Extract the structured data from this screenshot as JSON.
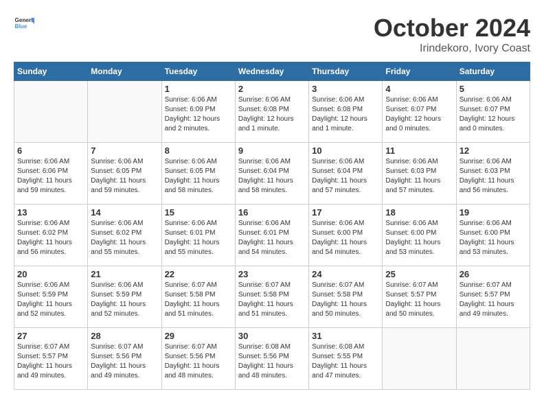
{
  "logo": {
    "general": "General",
    "blue": "Blue"
  },
  "header": {
    "month": "October 2024",
    "location": "Irindekoro, Ivory Coast"
  },
  "weekdays": [
    "Sunday",
    "Monday",
    "Tuesday",
    "Wednesday",
    "Thursday",
    "Friday",
    "Saturday"
  ],
  "weeks": [
    [
      {
        "day": "",
        "info": ""
      },
      {
        "day": "",
        "info": ""
      },
      {
        "day": "1",
        "info": "Sunrise: 6:06 AM\nSunset: 6:09 PM\nDaylight: 12 hours\nand 2 minutes."
      },
      {
        "day": "2",
        "info": "Sunrise: 6:06 AM\nSunset: 6:08 PM\nDaylight: 12 hours\nand 1 minute."
      },
      {
        "day": "3",
        "info": "Sunrise: 6:06 AM\nSunset: 6:08 PM\nDaylight: 12 hours\nand 1 minute."
      },
      {
        "day": "4",
        "info": "Sunrise: 6:06 AM\nSunset: 6:07 PM\nDaylight: 12 hours\nand 0 minutes."
      },
      {
        "day": "5",
        "info": "Sunrise: 6:06 AM\nSunset: 6:07 PM\nDaylight: 12 hours\nand 0 minutes."
      }
    ],
    [
      {
        "day": "6",
        "info": "Sunrise: 6:06 AM\nSunset: 6:06 PM\nDaylight: 11 hours\nand 59 minutes."
      },
      {
        "day": "7",
        "info": "Sunrise: 6:06 AM\nSunset: 6:05 PM\nDaylight: 11 hours\nand 59 minutes."
      },
      {
        "day": "8",
        "info": "Sunrise: 6:06 AM\nSunset: 6:05 PM\nDaylight: 11 hours\nand 58 minutes."
      },
      {
        "day": "9",
        "info": "Sunrise: 6:06 AM\nSunset: 6:04 PM\nDaylight: 11 hours\nand 58 minutes."
      },
      {
        "day": "10",
        "info": "Sunrise: 6:06 AM\nSunset: 6:04 PM\nDaylight: 11 hours\nand 57 minutes."
      },
      {
        "day": "11",
        "info": "Sunrise: 6:06 AM\nSunset: 6:03 PM\nDaylight: 11 hours\nand 57 minutes."
      },
      {
        "day": "12",
        "info": "Sunrise: 6:06 AM\nSunset: 6:03 PM\nDaylight: 11 hours\nand 56 minutes."
      }
    ],
    [
      {
        "day": "13",
        "info": "Sunrise: 6:06 AM\nSunset: 6:02 PM\nDaylight: 11 hours\nand 56 minutes."
      },
      {
        "day": "14",
        "info": "Sunrise: 6:06 AM\nSunset: 6:02 PM\nDaylight: 11 hours\nand 55 minutes."
      },
      {
        "day": "15",
        "info": "Sunrise: 6:06 AM\nSunset: 6:01 PM\nDaylight: 11 hours\nand 55 minutes."
      },
      {
        "day": "16",
        "info": "Sunrise: 6:06 AM\nSunset: 6:01 PM\nDaylight: 11 hours\nand 54 minutes."
      },
      {
        "day": "17",
        "info": "Sunrise: 6:06 AM\nSunset: 6:00 PM\nDaylight: 11 hours\nand 54 minutes."
      },
      {
        "day": "18",
        "info": "Sunrise: 6:06 AM\nSunset: 6:00 PM\nDaylight: 11 hours\nand 53 minutes."
      },
      {
        "day": "19",
        "info": "Sunrise: 6:06 AM\nSunset: 6:00 PM\nDaylight: 11 hours\nand 53 minutes."
      }
    ],
    [
      {
        "day": "20",
        "info": "Sunrise: 6:06 AM\nSunset: 5:59 PM\nDaylight: 11 hours\nand 52 minutes."
      },
      {
        "day": "21",
        "info": "Sunrise: 6:06 AM\nSunset: 5:59 PM\nDaylight: 11 hours\nand 52 minutes."
      },
      {
        "day": "22",
        "info": "Sunrise: 6:07 AM\nSunset: 5:58 PM\nDaylight: 11 hours\nand 51 minutes."
      },
      {
        "day": "23",
        "info": "Sunrise: 6:07 AM\nSunset: 5:58 PM\nDaylight: 11 hours\nand 51 minutes."
      },
      {
        "day": "24",
        "info": "Sunrise: 6:07 AM\nSunset: 5:58 PM\nDaylight: 11 hours\nand 50 minutes."
      },
      {
        "day": "25",
        "info": "Sunrise: 6:07 AM\nSunset: 5:57 PM\nDaylight: 11 hours\nand 50 minutes."
      },
      {
        "day": "26",
        "info": "Sunrise: 6:07 AM\nSunset: 5:57 PM\nDaylight: 11 hours\nand 49 minutes."
      }
    ],
    [
      {
        "day": "27",
        "info": "Sunrise: 6:07 AM\nSunset: 5:57 PM\nDaylight: 11 hours\nand 49 minutes."
      },
      {
        "day": "28",
        "info": "Sunrise: 6:07 AM\nSunset: 5:56 PM\nDaylight: 11 hours\nand 49 minutes."
      },
      {
        "day": "29",
        "info": "Sunrise: 6:07 AM\nSunset: 5:56 PM\nDaylight: 11 hours\nand 48 minutes."
      },
      {
        "day": "30",
        "info": "Sunrise: 6:08 AM\nSunset: 5:56 PM\nDaylight: 11 hours\nand 48 minutes."
      },
      {
        "day": "31",
        "info": "Sunrise: 6:08 AM\nSunset: 5:55 PM\nDaylight: 11 hours\nand 47 minutes."
      },
      {
        "day": "",
        "info": ""
      },
      {
        "day": "",
        "info": ""
      }
    ]
  ]
}
